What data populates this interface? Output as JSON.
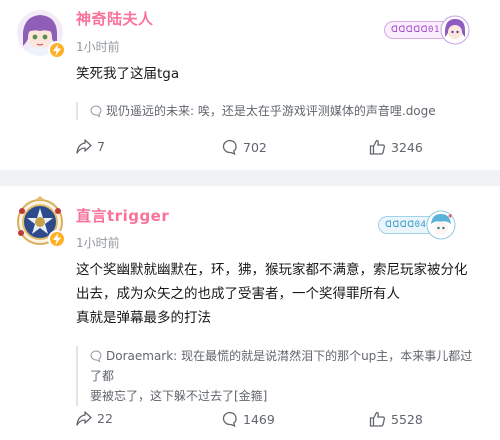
{
  "posts": [
    {
      "username": "神奇陆夫人",
      "time": "1小时前",
      "medal": "ᗡᗡᗡᗡᗡ01",
      "text_lines": [
        "笑死我了这届tga"
      ],
      "reply": {
        "author": "现仍遥远的未来:",
        "text": "唉，还是太在乎游戏评测媒体的声音哩.doge"
      },
      "share_count": "7",
      "comment_count": "702",
      "like_count": "3246"
    },
    {
      "username": "直言trigger",
      "time": "1小时前",
      "medal": "ᗡᗡᗡᗡ04",
      "text_lines": [
        "这个奖幽默就幽默在，环，狒，猴玩家都不满意，索尼玩家被分化",
        "出去，成为众矢之的也成了受害者，一个奖得罪所有人",
        "真就是弹幕最多的打法"
      ],
      "reply": {
        "author": "Doraemark:",
        "text_lines": [
          "现在最慌的就是说潸然泪下的那个up主，本来事儿都过了都",
          "要被忘了，这下躲不过去了[金箍]"
        ]
      },
      "share_count": "22",
      "comment_count": "1469",
      "like_count": "5528"
    }
  ],
  "icons": {
    "share": "share-arrow-icon",
    "comment": "comment-bubble-icon",
    "like": "thumbs-up-icon",
    "quote": "quote-bubble-icon",
    "badge": "lightning-bolt-icon"
  },
  "colors": {
    "username": "#fb7299",
    "badge": "#ffb027",
    "text": "#18191c",
    "meta": "#9499a0"
  }
}
